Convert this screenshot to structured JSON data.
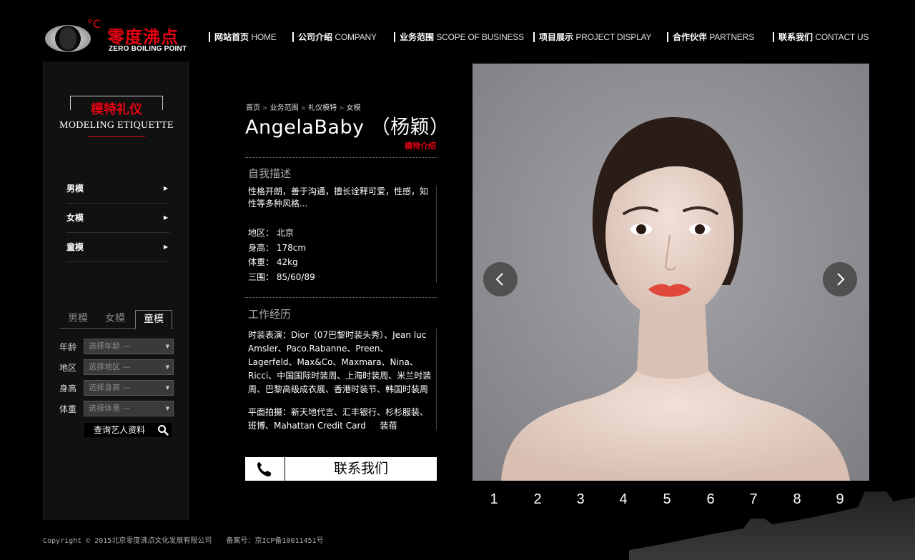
{
  "logo": {
    "degree": "°C",
    "cn": "零度沸点",
    "en": "ZERO BOILING POINT"
  },
  "nav": [
    {
      "cn": "网站首页",
      "en": "HOME"
    },
    {
      "cn": "公司介绍",
      "en": "COMPANY"
    },
    {
      "cn": "业务范围",
      "en": "SCOPE OF BUSINESS"
    },
    {
      "cn": "项目展示",
      "en": "PROJECT DISPLAY"
    },
    {
      "cn": "合作伙伴",
      "en": "PARTNERS"
    },
    {
      "cn": "联系我们",
      "en": "CONTACT US"
    }
  ],
  "sidebar": {
    "title_cn": "模特礼仪",
    "title_en": "MODELING ETIQUETTE",
    "menu": [
      "男模",
      "女模",
      "童模"
    ],
    "tabs": [
      "男模",
      "女模",
      "童模"
    ],
    "active_tab": 2,
    "filters": [
      {
        "label": "年龄",
        "placeholder": "选择年龄 —"
      },
      {
        "label": "地区",
        "placeholder": "选择地区 —"
      },
      {
        "label": "身高",
        "placeholder": "选择身高 —"
      },
      {
        "label": "体重",
        "placeholder": "选择体重 —"
      }
    ],
    "query_label": "查询艺人资料"
  },
  "breadcrumb": [
    "首页",
    "业务范围",
    "礼仪模特",
    "女模"
  ],
  "breadcrumb_sep": ">",
  "model": {
    "name": "AngelaBaby （杨颖）",
    "intro_tag": "模特介绍",
    "desc_title": "自我描述",
    "desc": "性格开朗，善于沟通，擅长诠释可爱，性感，知性等多种风格...",
    "info": [
      "地区： 北京",
      "身高： 178cm",
      "体重： 42kg",
      "三围： 85/60/89"
    ],
    "exp_title": "工作经历",
    "exp_show": "时装表演：Dior（07巴黎时装头秀）、Jean luc Amsler、Paco.Rabanne、Preen、Lagerfeld、Max&Co、Maxmara、Nina、 Ricci、中国国际时装周、上海时装周、米兰时装周、巴黎高级成衣展、香港时装节、韩国时装周",
    "exp_print": "平面拍摄：新天地代言、汇丰银行、杉杉服装、班博、Mahattan Credit Card 　 装蓓",
    "contact_label": "联系我们"
  },
  "pager": [
    "1",
    "2",
    "3",
    "4",
    "5",
    "6",
    "7",
    "8",
    "9"
  ],
  "footer": {
    "copyright": "Copyright © 2015北京零度沸点文化发展有限公司",
    "icp": "备案号：京ICP备10011451号"
  },
  "colors": {
    "accent": "#e60012",
    "background": "#000000",
    "sidebar": "#111111"
  }
}
